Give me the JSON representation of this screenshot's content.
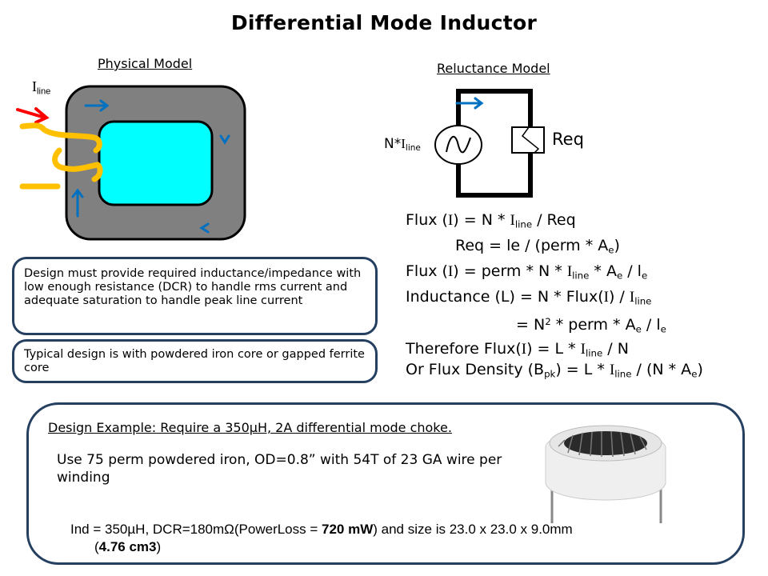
{
  "title": "Differential Mode Inductor",
  "physical_model": {
    "label": "Physical Model",
    "current_label": {
      "main": "I",
      "sub": "line"
    }
  },
  "reluctance_model": {
    "label": "Reluctance Model",
    "source_label": {
      "prefix": "N*",
      "main": "I",
      "sub": "line"
    },
    "reluctance_label": "Req"
  },
  "equations": [
    {
      "parts": [
        "Flux (",
        "I",
        ") = N * ",
        "I",
        "line",
        " / Req"
      ]
    },
    {
      "text": "Req =  le / (perm * A",
      "sub": "e",
      "tail": ")"
    },
    {
      "a": "Flux (",
      "b": "I",
      "c": ") = perm * N * ",
      "d": "I",
      "e": "line",
      "f": " *  A",
      "g": "e",
      "h": " / l",
      "i": "e"
    },
    {
      "a": "Inductance (L) = N * Flux(",
      "b": "I",
      "c": ") / ",
      "d": "I",
      "e": "line"
    },
    {
      "a": "= N",
      "sup": "2",
      "b": " * perm * A",
      "c": "e",
      "d": " / l",
      "e": "e"
    },
    {
      "a": "Therefore Flux(",
      "b": "I",
      "c": ") = L * ",
      "d": "I",
      "e": "line",
      "f": " / N"
    },
    {
      "a": "Or Flux Density (B",
      "b": "pk",
      "c": ") = L * ",
      "d": "I",
      "e": "line",
      "f": " / (N * A",
      "g": "e",
      "h": ")"
    }
  ],
  "notes": {
    "design": "Design must provide required inductance/impedance with low enough resistance (DCR) to handle rms current and adequate saturation to handle peak line current",
    "typical": "Typical design is with powdered iron core or gapped ferrite core"
  },
  "example": {
    "title": "Design Example: Require a 350µH, 2A differential mode choke.",
    "use": "Use 75 perm powdered iron, OD=0.8” with 54T of 23 GA wire per winding",
    "result": {
      "a": "Ind = 350µH, DCR=180mΩ(PowerLoss = ",
      "power": "720 mW",
      "b": ") and size is 23.0 x 23.0 x 9.0mm",
      "c": "(",
      "volume": "4.76 cm3",
      "d": ")"
    },
    "image_alt": "toroidal inductor photo"
  },
  "colors": {
    "core": "#808080",
    "window": "#00ffff",
    "winding": "#ffc000",
    "flux_arrow": "#0070c0",
    "current_arrow": "#ff0000",
    "box_border": "#243f60"
  }
}
